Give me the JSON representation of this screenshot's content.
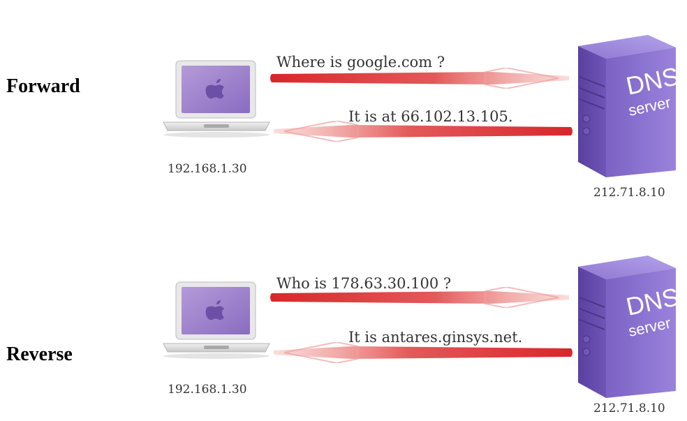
{
  "forward": {
    "label": "Forward",
    "client_ip": "192.168.1.30",
    "server_ip": "212.71.8.10",
    "query": "Where is google.com ?",
    "response": "It is at 66.102.13.105."
  },
  "reverse": {
    "label": "Reverse",
    "client_ip": "192.168.1.30",
    "server_ip": "212.71.8.10",
    "query": "Who is 178.63.30.100 ?",
    "response": "It is antares.ginsys.net."
  },
  "server": {
    "title": "DNS",
    "subtitle": "server"
  },
  "colors": {
    "arrow": "#e0383a",
    "server_purple": "#7a5fc0",
    "laptop_screen": "#9a7ec9"
  }
}
